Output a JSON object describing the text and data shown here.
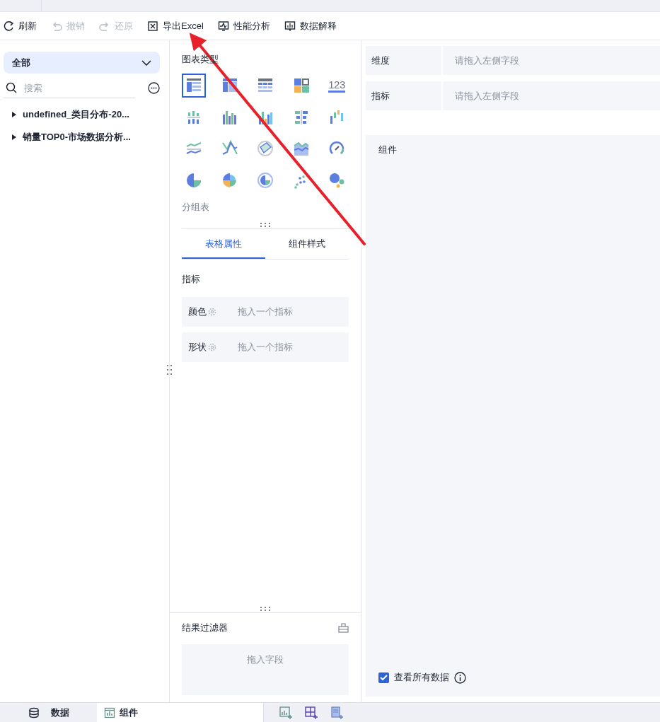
{
  "toolbar": [
    {
      "kind": "refresh",
      "label": "刷新",
      "disabled": false
    },
    {
      "kind": "undo",
      "label": "撤销",
      "disabled": true
    },
    {
      "kind": "redo",
      "label": "还原",
      "disabled": true
    },
    {
      "kind": "excel",
      "label": "导出Excel",
      "disabled": false
    },
    {
      "kind": "perf",
      "label": "性能分析",
      "disabled": false
    },
    {
      "kind": "explain",
      "label": "数据解释",
      "disabled": false
    }
  ],
  "left_panel": {
    "dropdown": "全部",
    "search": {
      "placeholder": "搜索"
    },
    "tree": [
      {
        "label": "undefined_类目分布-20...",
        "expanded": false
      },
      {
        "label": "销量TOP0-市场数据分析...",
        "expanded": false
      }
    ]
  },
  "chart_types": {
    "title": "图表类型",
    "items": [
      {
        "kind": "group-table",
        "selected": true
      },
      {
        "kind": "cross-table",
        "selected": false
      },
      {
        "kind": "detail-table",
        "selected": false
      },
      {
        "kind": "block",
        "selected": false
      },
      {
        "kind": "number",
        "label": "123",
        "selected": false
      },
      {
        "kind": "stack-bar",
        "selected": false
      },
      {
        "kind": "multi-bar",
        "selected": false
      },
      {
        "kind": "combo-bar",
        "selected": false
      },
      {
        "kind": "bar-h",
        "selected": false
      },
      {
        "kind": "waterfall",
        "selected": false
      },
      {
        "kind": "line",
        "selected": false
      },
      {
        "kind": "polyline",
        "selected": false
      },
      {
        "kind": "radar",
        "selected": false
      },
      {
        "kind": "area",
        "selected": false
      },
      {
        "kind": "gauge",
        "selected": false
      },
      {
        "kind": "pie",
        "selected": false
      },
      {
        "kind": "rose",
        "selected": false
      },
      {
        "kind": "ring",
        "selected": false
      },
      {
        "kind": "scatter",
        "selected": false
      },
      {
        "kind": "bubble",
        "selected": false
      }
    ],
    "current": "分组表"
  },
  "property_tabs": [
    {
      "label": "表格属性",
      "selected": true
    },
    {
      "label": "组件样式",
      "selected": false
    }
  ],
  "measures": {
    "title": "指标",
    "rows": [
      {
        "label": "颜色",
        "placeholder": "拖入一个指标"
      },
      {
        "label": "形状",
        "placeholder": "拖入一个指标"
      }
    ]
  },
  "result_filter": {
    "title": "结果过滤器",
    "placeholder": "拖入字段"
  },
  "fields": [
    {
      "label": "维度",
      "placeholder": "请拖入左侧字段"
    },
    {
      "label": "指标",
      "placeholder": "请拖入左侧字段"
    }
  ],
  "component": {
    "title": "组件",
    "show_all": {
      "label": "查看所有数据",
      "checked": true
    }
  },
  "bottom_tabs": [
    {
      "kind": "data",
      "label": "数据",
      "selected": false
    },
    {
      "kind": "component",
      "label": "组件",
      "selected": true
    }
  ]
}
